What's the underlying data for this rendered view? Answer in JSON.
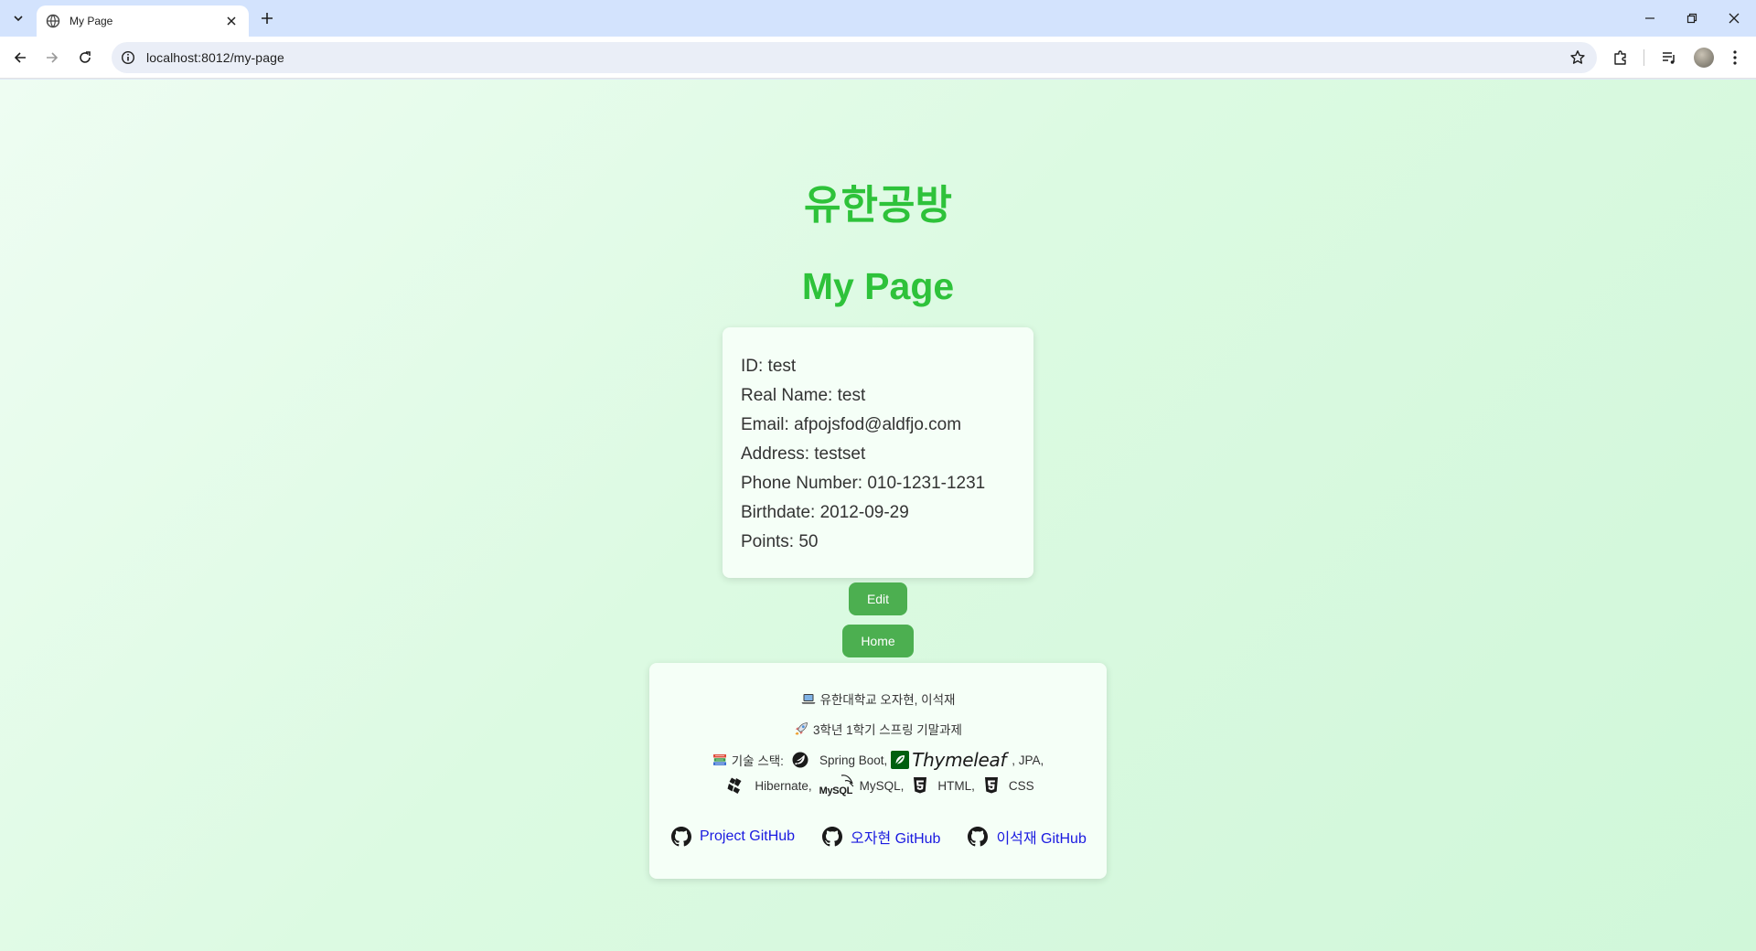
{
  "browser": {
    "tab_title": "My Page",
    "url": "localhost:8012/my-page"
  },
  "page": {
    "site_title": "유한공방",
    "title": "My Page"
  },
  "profile": [
    {
      "label": "ID",
      "value": "test",
      "text": "ID: test"
    },
    {
      "label": "Real Name",
      "value": "test",
      "text": "Real Name: test"
    },
    {
      "label": "Email",
      "value": "afpojsfod@aldfjo.com",
      "text": "Email: afpojsfod@aldfjo.com"
    },
    {
      "label": "Address",
      "value": "testset",
      "text": "Address: testset"
    },
    {
      "label": "Phone Number",
      "value": "010-1231-1231",
      "text": "Phone Number: 010-1231-1231"
    },
    {
      "label": "Birthdate",
      "value": "2012-09-29",
      "text": "Birthdate: 2012-09-29"
    },
    {
      "label": "Points",
      "value": "50",
      "text": "Points: 50"
    }
  ],
  "buttons": {
    "edit": "Edit",
    "home": "Home"
  },
  "footer": {
    "line1": "유한대학교 오자현, 이석재",
    "line2": "3학년 1학기 스프링 기말과제",
    "stack_label": "기술 스택:",
    "stack": {
      "spring": "Spring Boot,",
      "thymeleaf_logo": "Thymeleaf",
      "jpa": ", JPA,",
      "hibernate": "Hibernate,",
      "mysql_logo": "MySQL",
      "mysql": "MySQL,",
      "html": "HTML,",
      "css": "CSS"
    },
    "links": {
      "project": "Project GitHub",
      "ojahyun": "오자현 GitHub",
      "leeseokjae": "이석재 GitHub"
    },
    "icons": [
      "laptop-icon",
      "rocket-icon",
      "books-icon",
      "spring-icon",
      "thymeleaf-icon",
      "hibernate-icon",
      "mysql-icon",
      "html5-icon",
      "css3-icon",
      "github-icon"
    ]
  },
  "colors": {
    "title_green": "#2ec23a",
    "button_green": "#4caf50",
    "link_blue": "#1a1ae0"
  }
}
